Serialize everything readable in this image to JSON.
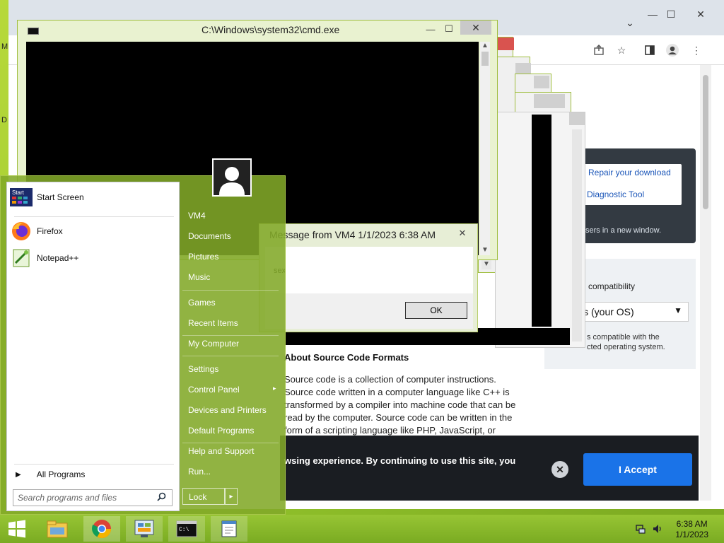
{
  "desktop": {
    "edge_letters": [
      "M",
      "D"
    ]
  },
  "browser": {
    "controls": {
      "minimize": "—",
      "maximize": "☐",
      "close": "✕",
      "tab_dropdown": "⌄"
    },
    "toolbar_icons": [
      "share-icon",
      "star-icon",
      "sidepanel-icon",
      "profile-icon",
      "menu-icon"
    ],
    "download_panel": {
      "link1": "Repair your download",
      "link2": "Diagnostic Tool",
      "note": "sers in a new window."
    },
    "compat": {
      "title": "compatibility",
      "selected": "ws (your OS)",
      "note_line1": "s compatible with the",
      "note_line2": "cted operating system."
    },
    "article": {
      "heading": "About Source Code Formats",
      "body": "Source code is a collection of computer instructions. Source code written in a computer language like C++ is transformed by a compiler into machine code that can be read by the computer. Source code can be written in the form of a scripting language like PHP, JavaScript, or"
    },
    "cookie": {
      "text": "wsing experience. By continuing to use this site, you",
      "accept_label": "I Accept",
      "close_glyph": "✕"
    }
  },
  "cmd_window": {
    "title": "C:\\Windows\\system32\\cmd.exe",
    "minimize": "—",
    "maximize": "☐",
    "close": "✕"
  },
  "message_box": {
    "title": "Message from VM4 1/1/2023 6:38 AM",
    "close": "✕",
    "text": "sex",
    "ok_label": "OK"
  },
  "start_menu": {
    "pinned": [
      {
        "label": "Start Screen",
        "icon": "start-screen-icon"
      },
      {
        "label": "Firefox",
        "icon": "firefox-icon"
      },
      {
        "label": "Notepad++",
        "icon": "notepad-plus-plus-icon"
      }
    ],
    "start_icon_text": "Start",
    "all_programs": "All Programs",
    "search_placeholder": "Search programs and files",
    "right_items": [
      "VM4",
      "Documents",
      "Pictures",
      "Music",
      "Games",
      "Recent Items",
      "My Computer",
      "Settings",
      "Control Panel",
      "Devices and Printers",
      "Default Programs",
      "Help and Support",
      "Run..."
    ],
    "lock_label": "Lock",
    "lock_arrow": "▸",
    "submenu_arrow": "▸"
  },
  "taskbar": {
    "apps": [
      "windows-start",
      "file-explorer",
      "chrome",
      "control-panel",
      "cmd",
      "notepad"
    ],
    "time": "6:38 AM",
    "date": "1/1/2023"
  },
  "colors": {
    "desktop_green": "#8fbf2a",
    "accept_blue": "#1a73e8",
    "cookie_bg": "#1a1d22",
    "link_blue": "#1a55b8"
  }
}
